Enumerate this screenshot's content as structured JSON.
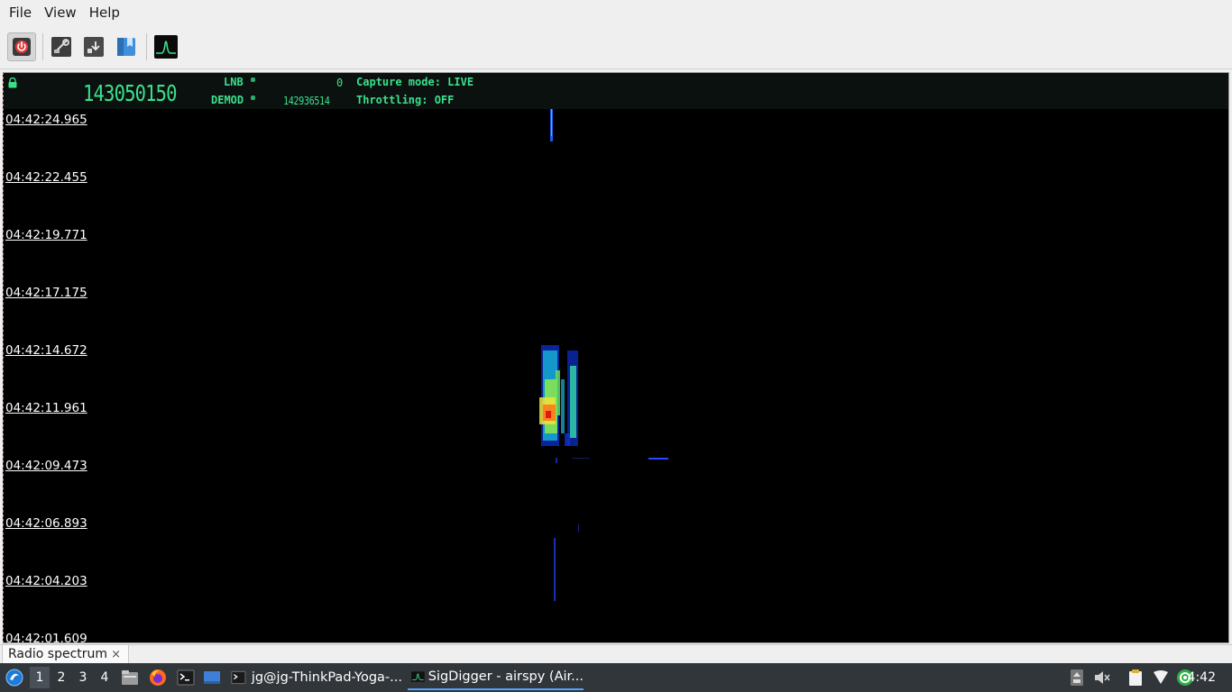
{
  "menu": [
    "File",
    "View",
    "Help"
  ],
  "toolbar": {
    "buttons": [
      "power-button",
      "settings-button",
      "add-module-button",
      "bookmarks-button",
      "spectrum-button"
    ]
  },
  "header": {
    "frequency_main": "143050150",
    "frequency_demod": "142936514",
    "lnb_label": "LNB",
    "lnb_value": "0",
    "demod_label": "DEMOD",
    "capture_mode": "Capture mode: LIVE",
    "throttling": "Throttling: OFF"
  },
  "waterfall": {
    "timestamps": [
      "04:42:24.965",
      "04:42:22.455",
      "04:42:19.771",
      "04:42:17.175",
      "04:42:14.672",
      "04:42:11.961",
      "04:42:09.473",
      "04:42:06.893",
      "04:42:04.203",
      "04:42:01.609"
    ]
  },
  "tabs": [
    {
      "label": "Radio spectrum",
      "close": "×"
    }
  ],
  "taskbar": {
    "workspaces": [
      "1",
      "2",
      "3",
      "4"
    ],
    "tasks": [
      {
        "label": "jg@jg-ThinkPad-Yoga-..."
      },
      {
        "label": "SigDigger - airspy (Air..."
      }
    ],
    "clock": "4:42"
  },
  "colors": {
    "lcd_green": "#3be08d",
    "taskbar_bg": "#31363b",
    "accent": "#4da3ff"
  }
}
